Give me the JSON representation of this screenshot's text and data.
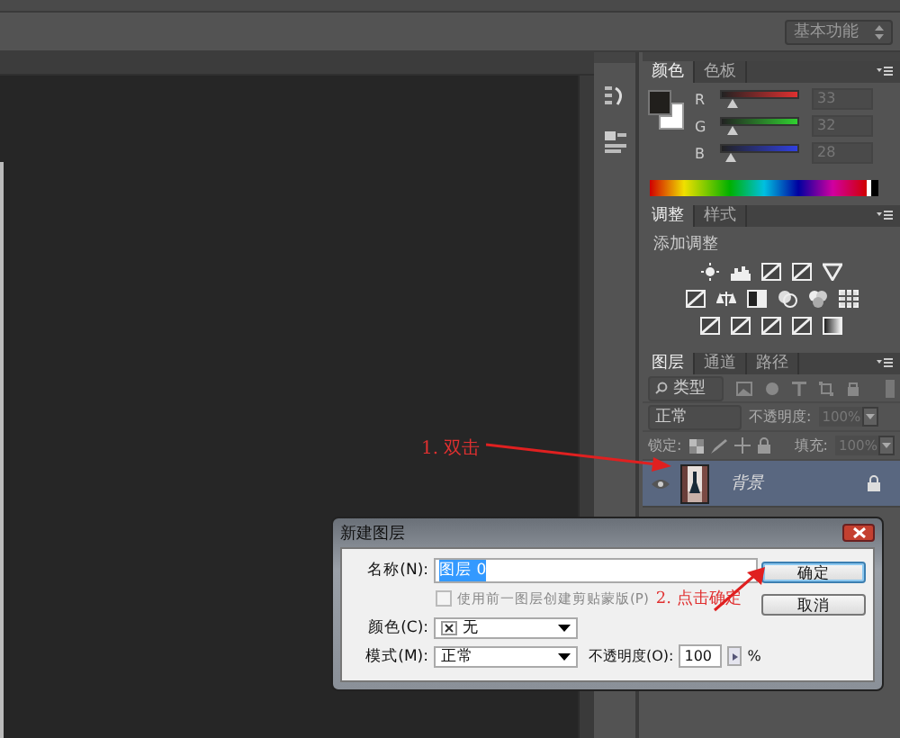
{
  "workspace": {
    "label": "基本功能"
  },
  "color_panel": {
    "tabs": [
      {
        "label": "颜色",
        "selected": true
      },
      {
        "label": "色板",
        "selected": false
      }
    ],
    "channels": [
      {
        "name": "R",
        "value": "33",
        "level": 0.13
      },
      {
        "name": "G",
        "value": "32",
        "level": 0.13
      },
      {
        "name": "B",
        "value": "28",
        "level": 0.11
      }
    ]
  },
  "adjustments_panel": {
    "tabs": [
      {
        "label": "调整",
        "selected": true
      },
      {
        "label": "样式",
        "selected": false
      }
    ],
    "heading": "添加调整"
  },
  "layers_panel": {
    "tabs": [
      {
        "label": "图层",
        "selected": true
      },
      {
        "label": "通道",
        "selected": false
      },
      {
        "label": "路径",
        "selected": false
      }
    ],
    "filter": "类型",
    "blend_mode": "正常",
    "opacity_label": "不透明度:",
    "opacity": "100%",
    "lock_label": "锁定:",
    "fill_label": "填充:",
    "fill": "100%",
    "layers": [
      {
        "name": "背景",
        "selected": true,
        "locked": true,
        "visible": true
      }
    ]
  },
  "annotations": [
    {
      "text": "1. 双击"
    },
    {
      "text": "2. 点击确定"
    }
  ],
  "dialog": {
    "title": "新建图层",
    "name_label": "名称(N):",
    "name_value": "图层 0",
    "clip_label": "使用前一图层创建剪贴蒙版(P)",
    "clip_checked": false,
    "clip_disabled": true,
    "color_label": "颜色(C):",
    "color_value": "无",
    "mode_label": "模式(M):",
    "mode_value": "正常",
    "opacity_label": "不透明度(O):",
    "opacity_value": "100",
    "percent": "%",
    "buttons": [
      {
        "label": "确定",
        "default": true
      },
      {
        "label": "取消",
        "default": false
      }
    ]
  }
}
